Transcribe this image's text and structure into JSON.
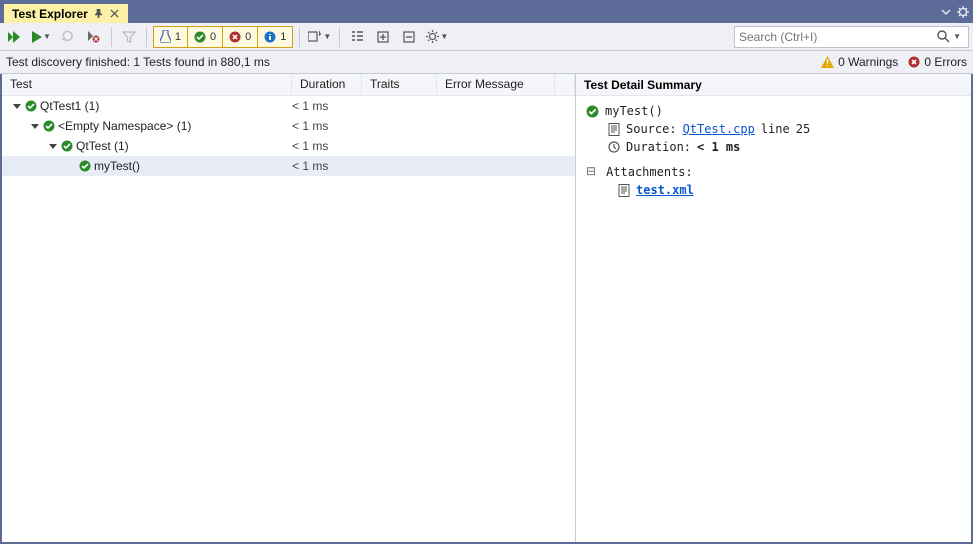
{
  "titlebar": {
    "title": "Test Explorer"
  },
  "toolbar": {
    "pills": {
      "flask": "1",
      "pass": "0",
      "fail": "0",
      "info": "1"
    },
    "search_placeholder": "Search (Ctrl+I)"
  },
  "status": {
    "text": "Test discovery finished: 1 Tests found in 880,1 ms",
    "warnings": "0 Warnings",
    "errors": "0 Errors"
  },
  "columns": {
    "test": "Test",
    "duration": "Duration",
    "traits": "Traits",
    "error": "Error Message"
  },
  "tree": [
    {
      "indent": 10,
      "expander": true,
      "icon": "pass",
      "label": "QtTest1 (1)",
      "duration": "< 1 ms"
    },
    {
      "indent": 28,
      "expander": true,
      "icon": "pass",
      "label": "<Empty Namespace> (1)",
      "duration": "< 1 ms"
    },
    {
      "indent": 46,
      "expander": true,
      "icon": "pass",
      "label": "QtTest (1)",
      "duration": "< 1 ms"
    },
    {
      "indent": 64,
      "expander": false,
      "icon": "pass",
      "label": "myTest()",
      "duration": "< 1 ms",
      "selected": true
    }
  ],
  "detail": {
    "header": "Test Detail Summary",
    "name": "myTest()",
    "source_label": "Source:",
    "source_file": "QtTest.cpp",
    "source_line_prefix": "line",
    "source_line": "25",
    "duration_label": "Duration:",
    "duration_value": "< 1 ms",
    "attachments_label": "Attachments:",
    "attachment_file": "test.xml"
  }
}
